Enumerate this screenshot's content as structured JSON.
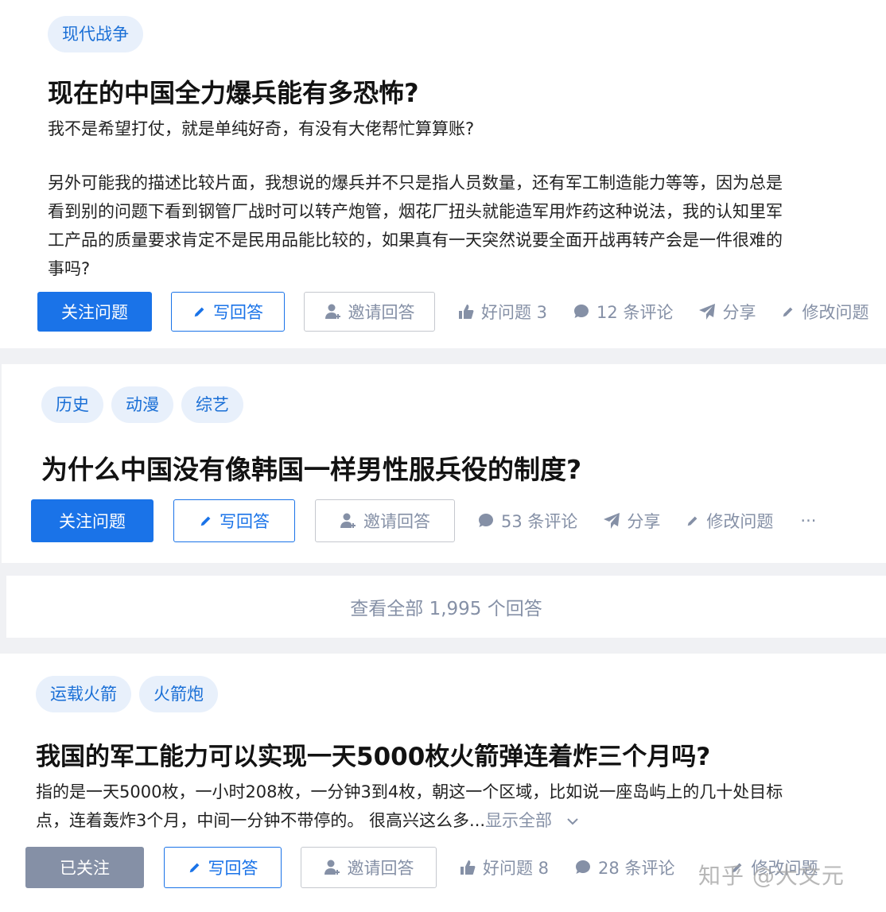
{
  "q1": {
    "tags": [
      "现代战争"
    ],
    "title": "现在的中国全力爆兵能有多恐怖?",
    "desc_line1": "我不是希望打仗，就是单纯好奇，有没有大佬帮忙算算账?",
    "desc_lines": [
      "另外可能我的描述比较片面，我想说的爆兵并不只是指人员数量，还有军工制造能力等等，因为总是",
      "看到别的问题下看到钢管厂战时可以转产炮管，烟花厂扭头就能造军用炸药这种说法，我的认知里军",
      "工产品的质量要求肯定不是民用品能比较的，如果真有一天突然说要全面开战再转产会是一件很难的",
      "事吗?"
    ],
    "follow_label": "关注问题",
    "answer_label": "写回答",
    "invite_label": "邀请回答",
    "good_label": "好问题 3",
    "comments_label": "12 条评论",
    "share_label": "分享",
    "edit_label": "修改问题"
  },
  "q2": {
    "tags": [
      "历史",
      "动漫",
      "综艺"
    ],
    "title": "为什么中国没有像韩国一样男性服兵役的制度?",
    "follow_label": "关注问题",
    "answer_label": "写回答",
    "invite_label": "邀请回答",
    "comments_label": "53 条评论",
    "share_label": "分享",
    "edit_label": "修改问题",
    "more_label": "···",
    "view_all": "查看全部 1,995 个回答"
  },
  "q3": {
    "tags": [
      "运载火箭",
      "火箭炮"
    ],
    "title": "我国的军工能力可以实现一天5000枚火箭弹连着炸三个月吗?",
    "desc_line1": "指的是一天5000枚，一小时208枚，一分钟3到4枚，朝这一个区域，比如说一座岛屿上的几十处目标",
    "desc_line2": "点，连着轰炸3个月，中间一分钟不带停的。 很高兴这么多...",
    "show_all": "显示全部",
    "followed_label": "已关注",
    "answer_label": "写回答",
    "invite_label": "邀请回答",
    "good_label": "好问题 8",
    "comments_label": "28 条评论",
    "edit_label": "修改问题"
  },
  "watermark": "知乎 @大文元",
  "colors": {
    "accent": "#1a73e8",
    "muted": "#8590a6",
    "tag_bg": "#e8f0fb"
  }
}
